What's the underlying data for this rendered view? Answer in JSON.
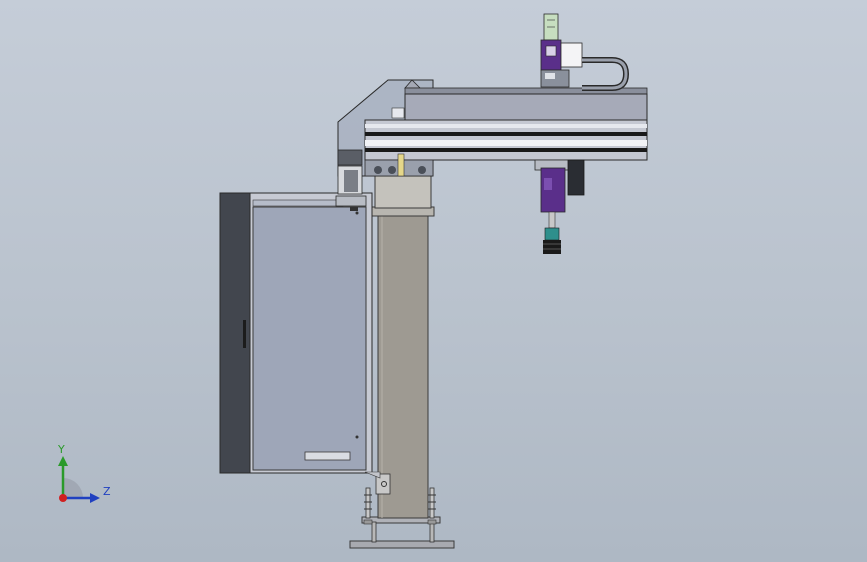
{
  "viewport": {
    "background_top": "#c5cdd8",
    "background_bottom": "#aeb8c4"
  },
  "triad": {
    "y_label": "Y",
    "z_label": "Z",
    "y_color": "#2a9a2a",
    "z_color": "#2040c0",
    "x_color": "#d02020"
  },
  "model": {
    "frame_color": "#9e9a92",
    "cabinet_color": "#9ea6b8",
    "beam_color": "#a6aab8",
    "accent_color": "#5a2f8a"
  }
}
